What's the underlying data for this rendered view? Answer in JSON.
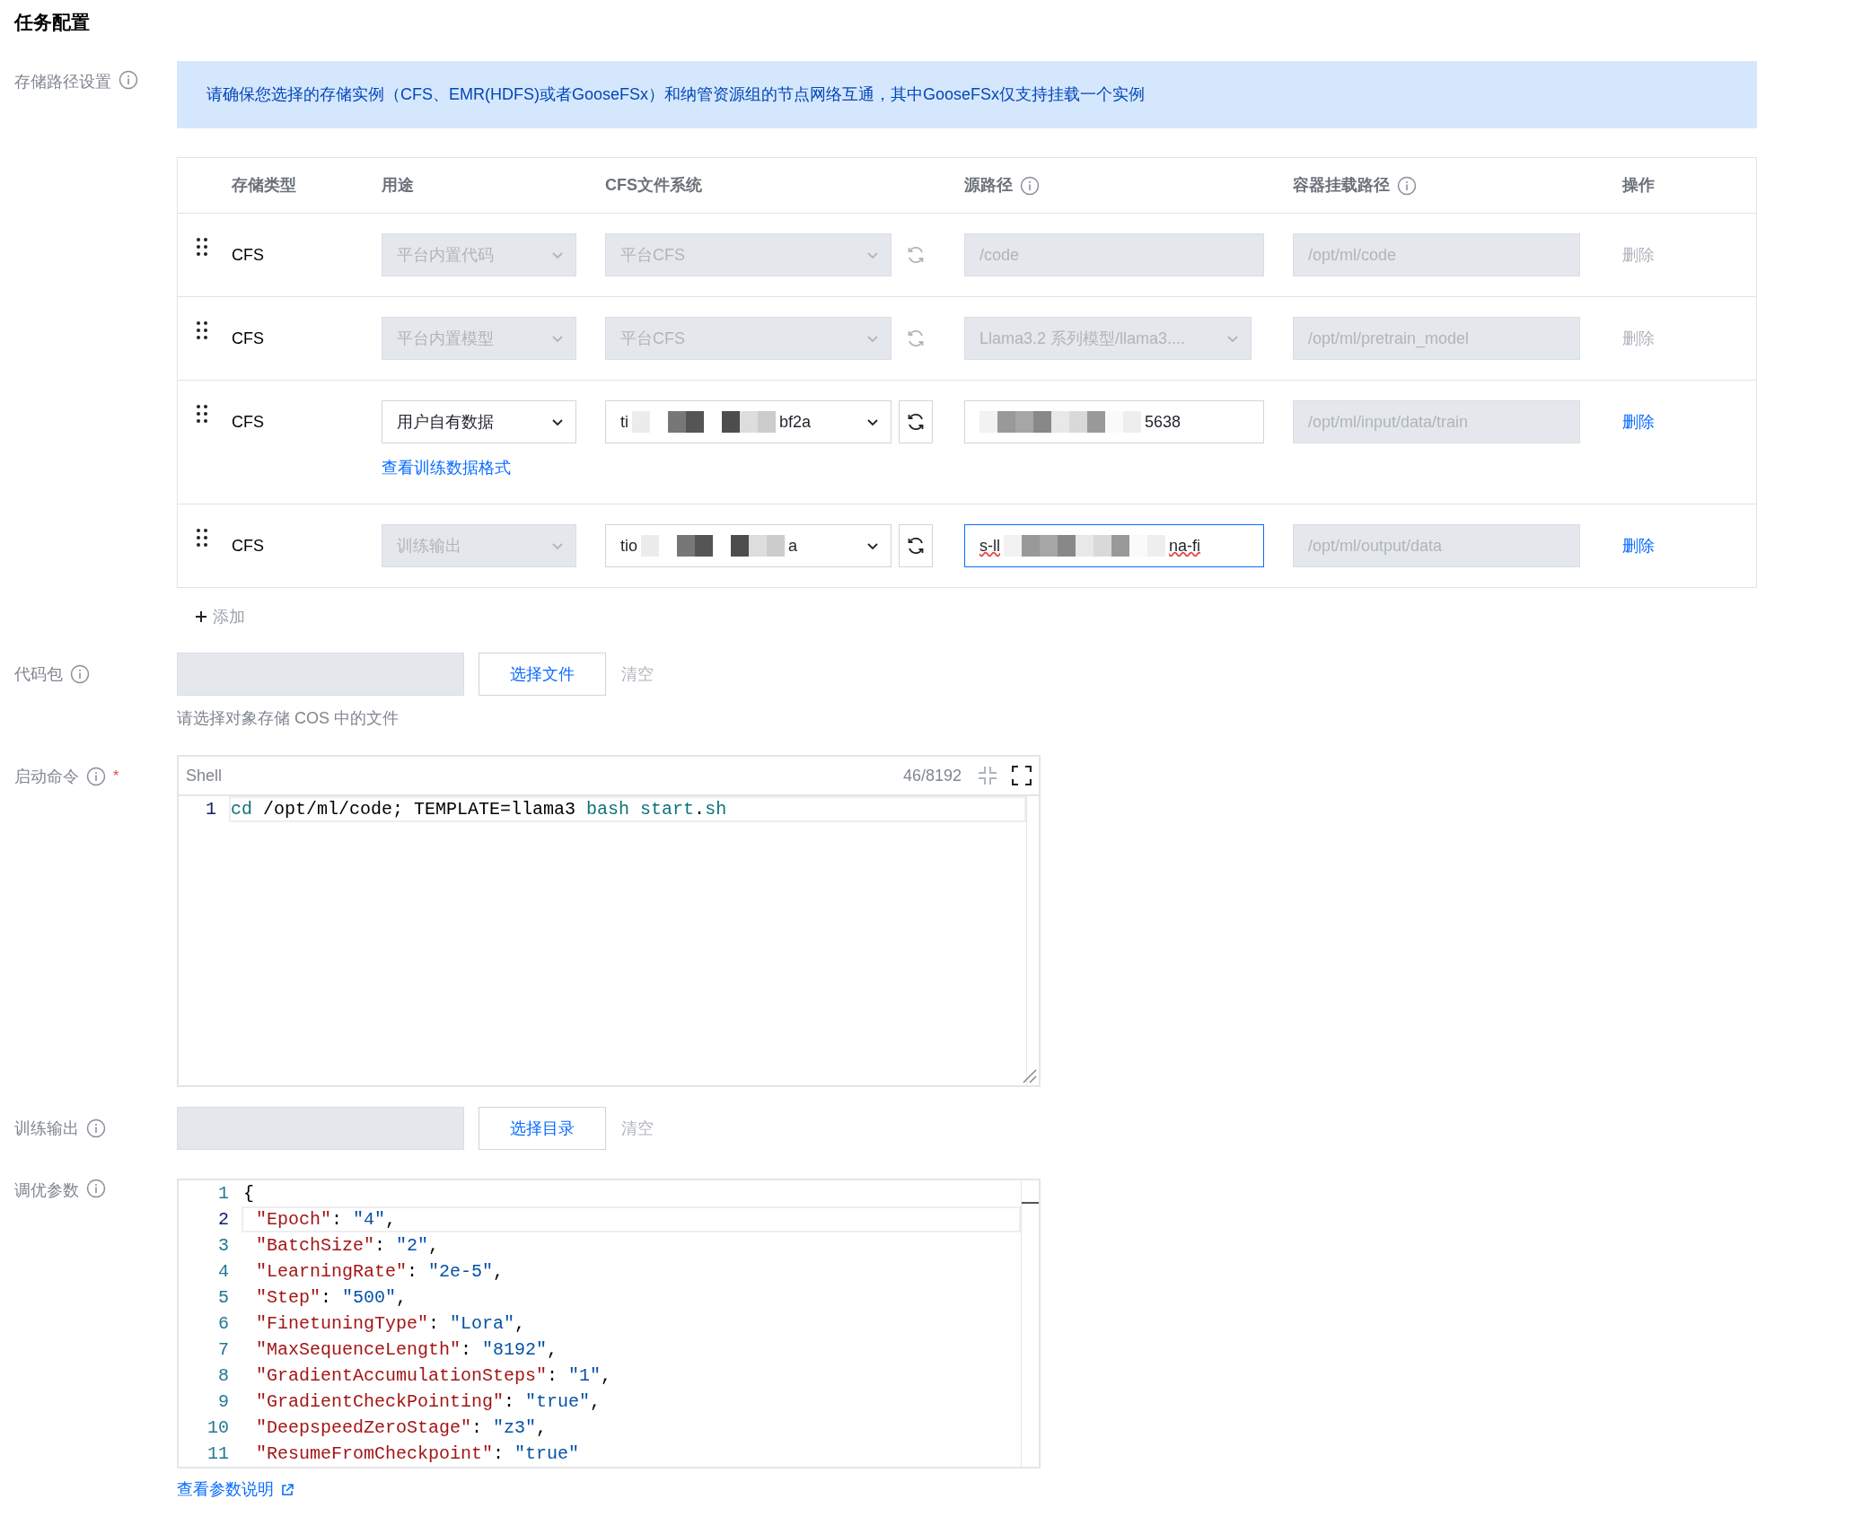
{
  "title": "任务配置",
  "storage": {
    "label": "存储路径设置",
    "notice": "请确保您选择的存储实例（CFS、EMR(HDFS)或者GooseFSx）和纳管资源组的节点网络互通，其中GooseFSx仅支持挂载一个实例",
    "columns": [
      "存储类型",
      "用途",
      "CFS文件系统",
      "源路径",
      "容器挂载路径",
      "操作"
    ],
    "rows": [
      {
        "type": "CFS",
        "usage": {
          "value": "平台内置代码",
          "disabled": true
        },
        "filesystem": {
          "parts": [
            "平台CFS"
          ],
          "disabled": true,
          "redacted": false
        },
        "source": {
          "kind": "input",
          "parts": [
            "/code"
          ],
          "disabled": true,
          "redacted": false,
          "focused": false
        },
        "mount": "/opt/ml/code",
        "delete": {
          "label": "删除",
          "disabled": true
        }
      },
      {
        "type": "CFS",
        "usage": {
          "value": "平台内置模型",
          "disabled": true
        },
        "filesystem": {
          "parts": [
            "平台CFS"
          ],
          "disabled": true,
          "redacted": false
        },
        "source": {
          "kind": "select",
          "parts": [
            "Llama3.2 系列模型/llama3...."
          ],
          "disabled": true,
          "redacted": false,
          "focused": false
        },
        "mount": "/opt/ml/pretrain_model",
        "delete": {
          "label": "删除",
          "disabled": true
        }
      },
      {
        "type": "CFS",
        "usage": {
          "value": "用户自有数据",
          "disabled": false,
          "link": "查看训练数据格式"
        },
        "filesystem": {
          "parts": [
            "ti",
            "bf2a"
          ],
          "disabled": false,
          "redacted": true
        },
        "source": {
          "kind": "input",
          "parts": [
            "5638"
          ],
          "disabled": false,
          "redacted": true,
          "focused": false
        },
        "mount": "/opt/ml/input/data/train",
        "delete": {
          "label": "删除",
          "disabled": false
        }
      },
      {
        "type": "CFS",
        "usage": {
          "value": "训练输出",
          "disabled": true
        },
        "filesystem": {
          "parts": [
            "tio",
            "a"
          ],
          "disabled": false,
          "redacted": true
        },
        "source": {
          "kind": "input",
          "parts": [
            "s-ll",
            "na-fi"
          ],
          "disabled": false,
          "redacted": true,
          "focused": true
        },
        "mount": "/opt/ml/output/data",
        "delete": {
          "label": "删除",
          "disabled": false
        }
      }
    ],
    "add": "添加"
  },
  "code_package": {
    "label": "代码包",
    "button": "选择文件",
    "clear": "清空",
    "hint": "请选择对象存储 COS 中的文件"
  },
  "start_command": {
    "label": "启动命令",
    "required_mark": "*",
    "language": "Shell",
    "count": "46/8192",
    "lines": [
      {
        "number": "1",
        "active": true,
        "tokens": [
          {
            "kind": "keyword",
            "text": "cd"
          },
          {
            "kind": "plain",
            "text": " /opt/ml/code; TEMPLATE=llama3 "
          },
          {
            "kind": "keyword",
            "text": "bash start"
          },
          {
            "kind": "plain",
            "text": "."
          },
          {
            "kind": "keyword",
            "text": "sh"
          }
        ]
      }
    ]
  },
  "training_output": {
    "label": "训练输出",
    "button": "选择目录",
    "clear": "清空"
  },
  "tuning_params": {
    "label": "调优参数",
    "link": "查看参数说明",
    "lines": [
      {
        "number": "1",
        "active": false,
        "tokens": [
          {
            "kind": "plain",
            "text": "{"
          }
        ]
      },
      {
        "number": "2",
        "active": true,
        "tokens": [
          {
            "kind": "key",
            "text": "\"Epoch\""
          },
          {
            "kind": "plain",
            "text": ": "
          },
          {
            "kind": "string",
            "text": "\"4\""
          },
          {
            "kind": "plain",
            "text": ","
          }
        ]
      },
      {
        "number": "3",
        "active": false,
        "tokens": [
          {
            "kind": "key",
            "text": "\"BatchSize\""
          },
          {
            "kind": "plain",
            "text": ": "
          },
          {
            "kind": "string",
            "text": "\"2\""
          },
          {
            "kind": "plain",
            "text": ","
          }
        ]
      },
      {
        "number": "4",
        "active": false,
        "tokens": [
          {
            "kind": "key",
            "text": "\"LearningRate\""
          },
          {
            "kind": "plain",
            "text": ": "
          },
          {
            "kind": "string",
            "text": "\"2e-5\""
          },
          {
            "kind": "plain",
            "text": ","
          }
        ]
      },
      {
        "number": "5",
        "active": false,
        "tokens": [
          {
            "kind": "key",
            "text": "\"Step\""
          },
          {
            "kind": "plain",
            "text": ": "
          },
          {
            "kind": "string",
            "text": "\"500\""
          },
          {
            "kind": "plain",
            "text": ","
          }
        ]
      },
      {
        "number": "6",
        "active": false,
        "tokens": [
          {
            "kind": "key",
            "text": "\"FinetuningType\""
          },
          {
            "kind": "plain",
            "text": ": "
          },
          {
            "kind": "string",
            "text": "\"Lora\""
          },
          {
            "kind": "plain",
            "text": ","
          }
        ]
      },
      {
        "number": "7",
        "active": false,
        "tokens": [
          {
            "kind": "key",
            "text": "\"MaxSequenceLength\""
          },
          {
            "kind": "plain",
            "text": ": "
          },
          {
            "kind": "string",
            "text": "\"8192\""
          },
          {
            "kind": "plain",
            "text": ","
          }
        ]
      },
      {
        "number": "8",
        "active": false,
        "tokens": [
          {
            "kind": "key",
            "text": "\"GradientAccumulationSteps\""
          },
          {
            "kind": "plain",
            "text": ": "
          },
          {
            "kind": "string",
            "text": "\"1\""
          },
          {
            "kind": "plain",
            "text": ","
          }
        ]
      },
      {
        "number": "9",
        "active": false,
        "tokens": [
          {
            "kind": "key",
            "text": "\"GradientCheckPointing\""
          },
          {
            "kind": "plain",
            "text": ": "
          },
          {
            "kind": "string",
            "text": "\"true\""
          },
          {
            "kind": "plain",
            "text": ","
          }
        ]
      },
      {
        "number": "10",
        "active": false,
        "tokens": [
          {
            "kind": "key",
            "text": "\"DeepspeedZeroStage\""
          },
          {
            "kind": "plain",
            "text": ": "
          },
          {
            "kind": "string",
            "text": "\"z3\""
          },
          {
            "kind": "plain",
            "text": ","
          }
        ]
      },
      {
        "number": "11",
        "active": false,
        "tokens": [
          {
            "kind": "key",
            "text": "\"ResumeFromCheckpoint\""
          },
          {
            "kind": "plain",
            "text": ": "
          },
          {
            "kind": "string",
            "text": "\"true\""
          }
        ]
      }
    ]
  }
}
